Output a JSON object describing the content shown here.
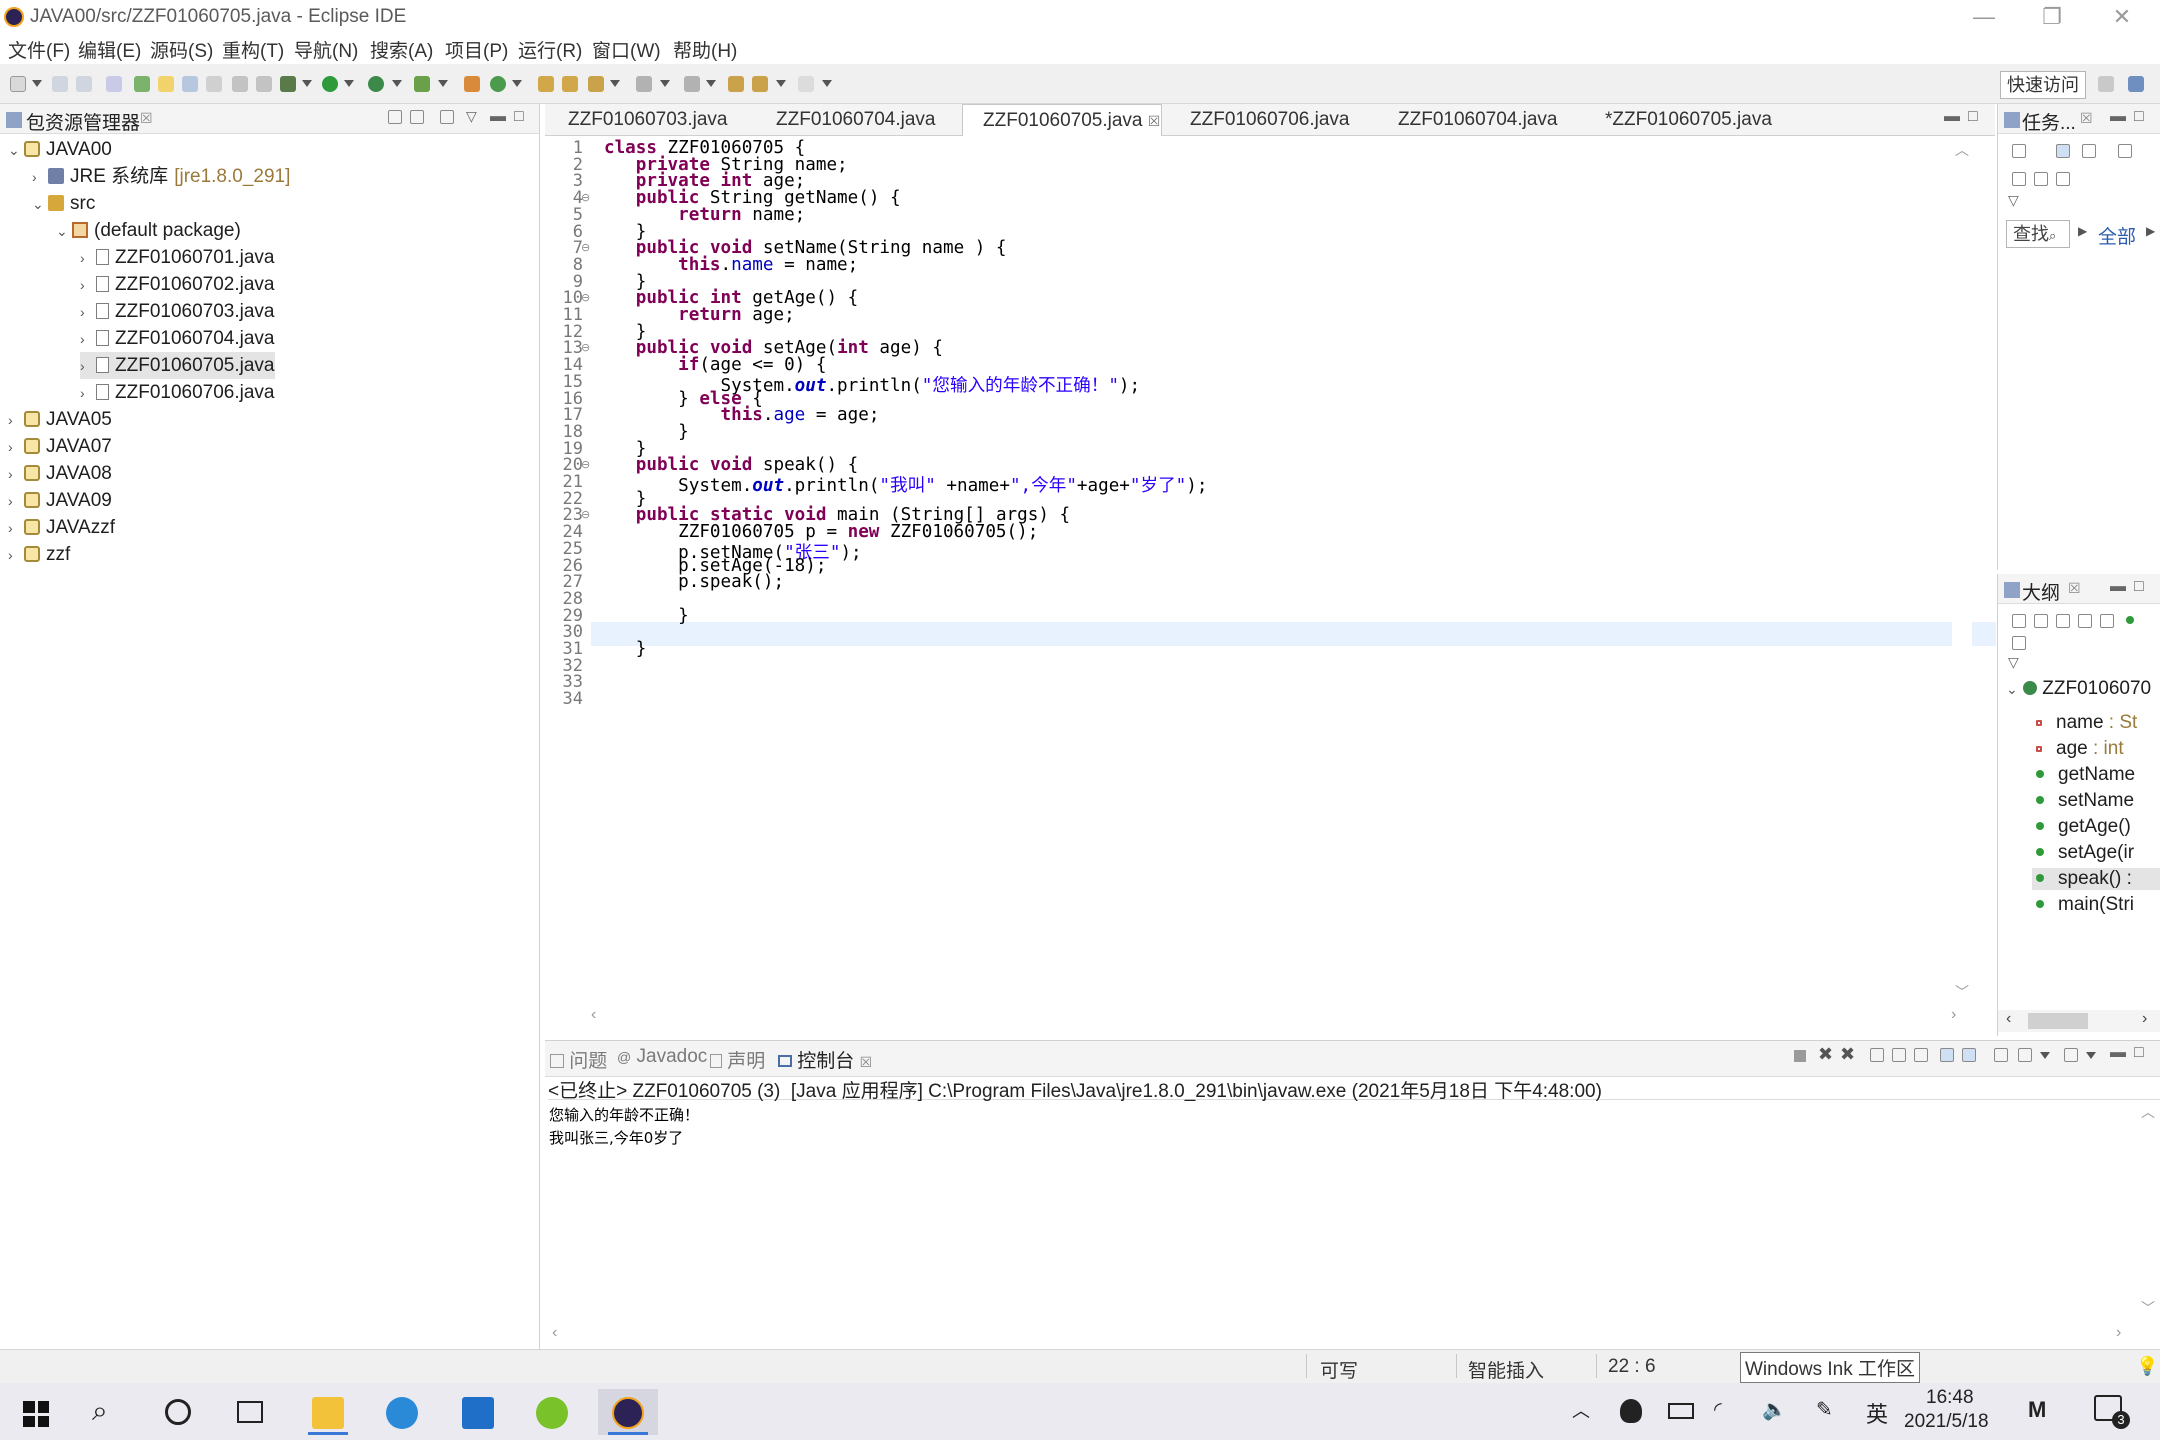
{
  "window": {
    "title": "JAVA00/src/ZZF01060705.java - Eclipse IDE",
    "minimize": "—",
    "restore": "❐",
    "close": "✕"
  },
  "menu": [
    "文件(F)",
    "编辑(E)",
    "源码(S)",
    "重构(T)",
    "导航(N)",
    "搜索(A)",
    "项目(P)",
    "运行(R)",
    "窗口(W)",
    "帮助(H)"
  ],
  "toolbar": {
    "quick_access": "快速访问"
  },
  "package_explorer": {
    "title": "包资源管理器",
    "tree": [
      {
        "label": "JAVA00",
        "level": 0,
        "expanded": true,
        "kind": "project"
      },
      {
        "label": "JRE 系统库",
        "suffix": "[jre1.8.0_291]",
        "level": 1,
        "expanded": false,
        "kind": "jre"
      },
      {
        "label": "src",
        "level": 1,
        "expanded": true,
        "kind": "src"
      },
      {
        "label": "(default package)",
        "level": 2,
        "expanded": true,
        "kind": "pkg"
      },
      {
        "label": "ZZF01060701.java",
        "level": 3,
        "expanded": false,
        "kind": "java"
      },
      {
        "label": "ZZF01060702.java",
        "level": 3,
        "expanded": false,
        "kind": "java"
      },
      {
        "label": "ZZF01060703.java",
        "level": 3,
        "expanded": false,
        "kind": "java"
      },
      {
        "label": "ZZF01060704.java",
        "level": 3,
        "expanded": false,
        "kind": "java"
      },
      {
        "label": "ZZF01060705.java",
        "level": 3,
        "expanded": false,
        "kind": "java",
        "selected": true
      },
      {
        "label": "ZZF01060706.java",
        "level": 3,
        "expanded": false,
        "kind": "java"
      },
      {
        "label": "JAVA05",
        "level": 0,
        "expanded": false,
        "kind": "project"
      },
      {
        "label": "JAVA07",
        "level": 0,
        "expanded": false,
        "kind": "project"
      },
      {
        "label": "JAVA08",
        "level": 0,
        "expanded": false,
        "kind": "project"
      },
      {
        "label": "JAVA09",
        "level": 0,
        "expanded": false,
        "kind": "project"
      },
      {
        "label": "JAVAzzf",
        "level": 0,
        "expanded": false,
        "kind": "project"
      },
      {
        "label": "zzf",
        "level": 0,
        "expanded": false,
        "kind": "project"
      }
    ]
  },
  "editor": {
    "tabs": [
      {
        "label": "ZZF01060703.java",
        "active": false
      },
      {
        "label": "ZZF01060704.java",
        "active": false
      },
      {
        "label": "ZZF01060705.java",
        "active": true,
        "close": "☒"
      },
      {
        "label": "ZZF01060706.java",
        "active": false
      },
      {
        "label": "ZZF01060704.java",
        "active": false
      },
      {
        "label": "*ZZF01060705.java",
        "active": false
      }
    ],
    "current_line": 22,
    "lines": [
      "class ZZF01060705 {",
      "   private String name;",
      "   private int age;",
      "   public String getName() {",
      "       return name;",
      "   }",
      "   public void setName(String name ) {",
      "       this.name = name;",
      "   }",
      "   public int getAge() {",
      "       return age;",
      "   }",
      "   public void setAge(int age) {",
      "       if(age <= 0) {",
      "           System.out.println(\"您输入的年龄不正确！\");",
      "       } else {",
      "           this.age = age;",
      "       }",
      "   }",
      "   public void speak() {",
      "       System.out.println(\"我叫\" +name+\",今年\"+age+\"岁了\");",
      "   }",
      "   public static void main (String[] args) {",
      "       ZZF01060705 p = new ZZF01060705();",
      "       p.setName(\"张三\");",
      "       p.setAge(-18);",
      "       p.speak();",
      "",
      "       }",
      "",
      "   }",
      "",
      "",
      ""
    ]
  },
  "tasks_panel": {
    "title": "任务...",
    "find": "查找",
    "all": "全部"
  },
  "outline": {
    "title": "大纲",
    "root": "ZZF0106070",
    "items": [
      {
        "name": "name",
        "type": " : St",
        "kind": "field"
      },
      {
        "name": "age",
        "type": " : int",
        "kind": "field"
      },
      {
        "name": "getName",
        "type": "",
        "kind": "method"
      },
      {
        "name": "setName",
        "type": "",
        "kind": "method"
      },
      {
        "name": "getAge()",
        "type": "",
        "kind": "method"
      },
      {
        "name": "setAge(ir",
        "type": "",
        "kind": "method"
      },
      {
        "name": "speak() :",
        "type": "",
        "kind": "method",
        "selected": true
      },
      {
        "name": "main(Stri",
        "type": "",
        "kind": "static"
      }
    ]
  },
  "console": {
    "tabs": [
      "问题",
      "Javadoc",
      "声明",
      "控制台"
    ],
    "header": "<已终止> ZZF01060705 (3)  [Java 应用程序] C:\\Program Files\\Java\\jre1.8.0_291\\bin\\javaw.exe (2021年5月18日 下午4:48:00)",
    "output": [
      "您输入的年龄不正确！",
      "我叫张三,今年0岁了"
    ]
  },
  "status": {
    "writable": "可写",
    "insert_mode": "智能插入",
    "position": "22 : 6",
    "ink": "Windows Ink 工作区"
  },
  "taskbar": {
    "ime": "英",
    "time": "16:48",
    "date": "2021/5/18",
    "notifications": "3"
  },
  "colors": {
    "keyword": "#7f0055",
    "field": "#0000c0",
    "string": "#2a00ff",
    "current_line": "#e8f2fe"
  }
}
